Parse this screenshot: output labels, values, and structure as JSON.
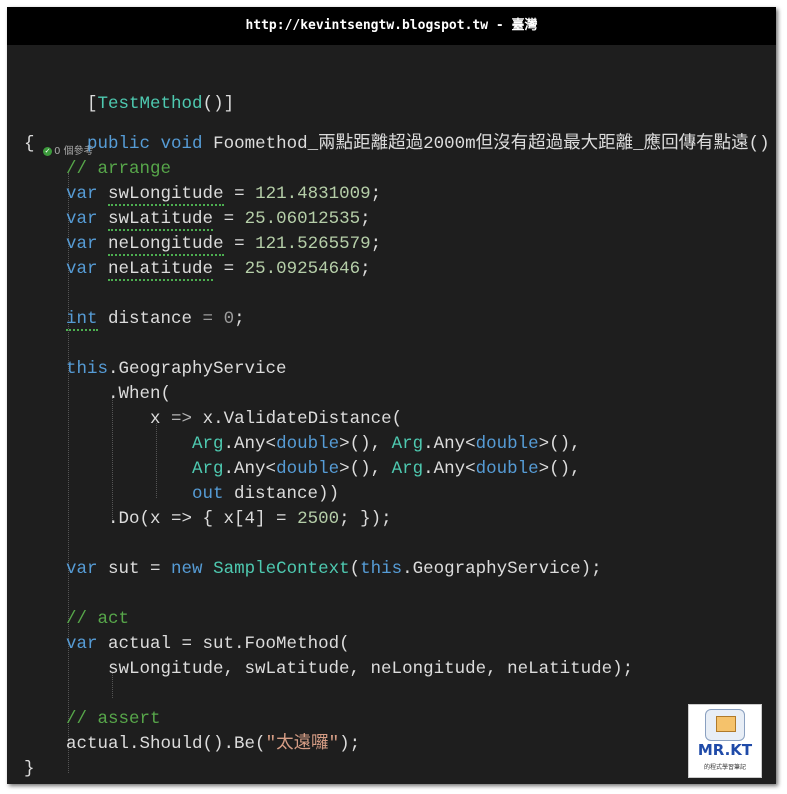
{
  "header": {
    "title": "http://kevintsengtw.blogspot.tw - 臺灣"
  },
  "codelens": {
    "check_icon": "check-circle-icon",
    "references": "0 個參考"
  },
  "code": {
    "attr_open": "[",
    "attr_name": "TestMethod",
    "attr_close": "()]",
    "kw_public": "public",
    "kw_void": "void",
    "method_name": "Foomethod_兩點距離超過2000m但沒有超過最大距離_應回傳有點遠()",
    "brace_open": "{",
    "cm_arrange": "// arrange",
    "kw_var": "var",
    "sw_lng_name": "swLongitude",
    "sw_lng_value": "121.4831009",
    "sw_lat_name": "swLatitude",
    "sw_lat_value": "25.06012535",
    "ne_lng_name": "neLongitude",
    "ne_lng_value": "121.5265579",
    "ne_lat_name": "neLatitude",
    "ne_lat_value": "25.09254646",
    "eq": " = ",
    "semi": ";",
    "kw_int": "int",
    "distance_name": " distance",
    "distance_eq": " = ",
    "distance_value": "0",
    "kw_this": "this",
    "geo_service": ".GeographyService",
    "when_call": ".When(",
    "lambda_x": "x",
    "lambda_arrow": " => ",
    "validate_call": "x.ValidateDistance(",
    "arg": "Arg",
    "any_open": ".Any<",
    "kw_double": "double",
    "any_close": ">()",
    "comma": ", ",
    "comma_end": ",",
    "kw_out": "out",
    "out_rest": " distance))",
    "do_open": ".Do(",
    "do_rest": "x => { x[4] = ",
    "do_value": "2500",
    "do_close": "; });",
    "sut_name": " sut = ",
    "kw_new": "new",
    "sample_context": "SampleContext",
    "paren_open": "(",
    "geo_arg": ".GeographyService);",
    "cm_act": "// act",
    "actual_decl": " actual = sut.FooMethod(",
    "act_args": "swLongitude, swLatitude, neLongitude, neLatitude);",
    "cm_assert": "// assert",
    "assert_call": "actual.Should().Be(",
    "assert_value": "\"太遠囉\"",
    "assert_close": ");",
    "brace_close": "}"
  },
  "logo": {
    "name": "MR.KT",
    "sub": "的程式學習筆記"
  },
  "colors": {
    "editor_bg": "#1e1e1e",
    "keyword": "#569cd6",
    "type": "#4ec9b0",
    "comment": "#57a64a",
    "number": "#b5cea8",
    "string": "#d69d85",
    "text": "#dcdcdc"
  }
}
